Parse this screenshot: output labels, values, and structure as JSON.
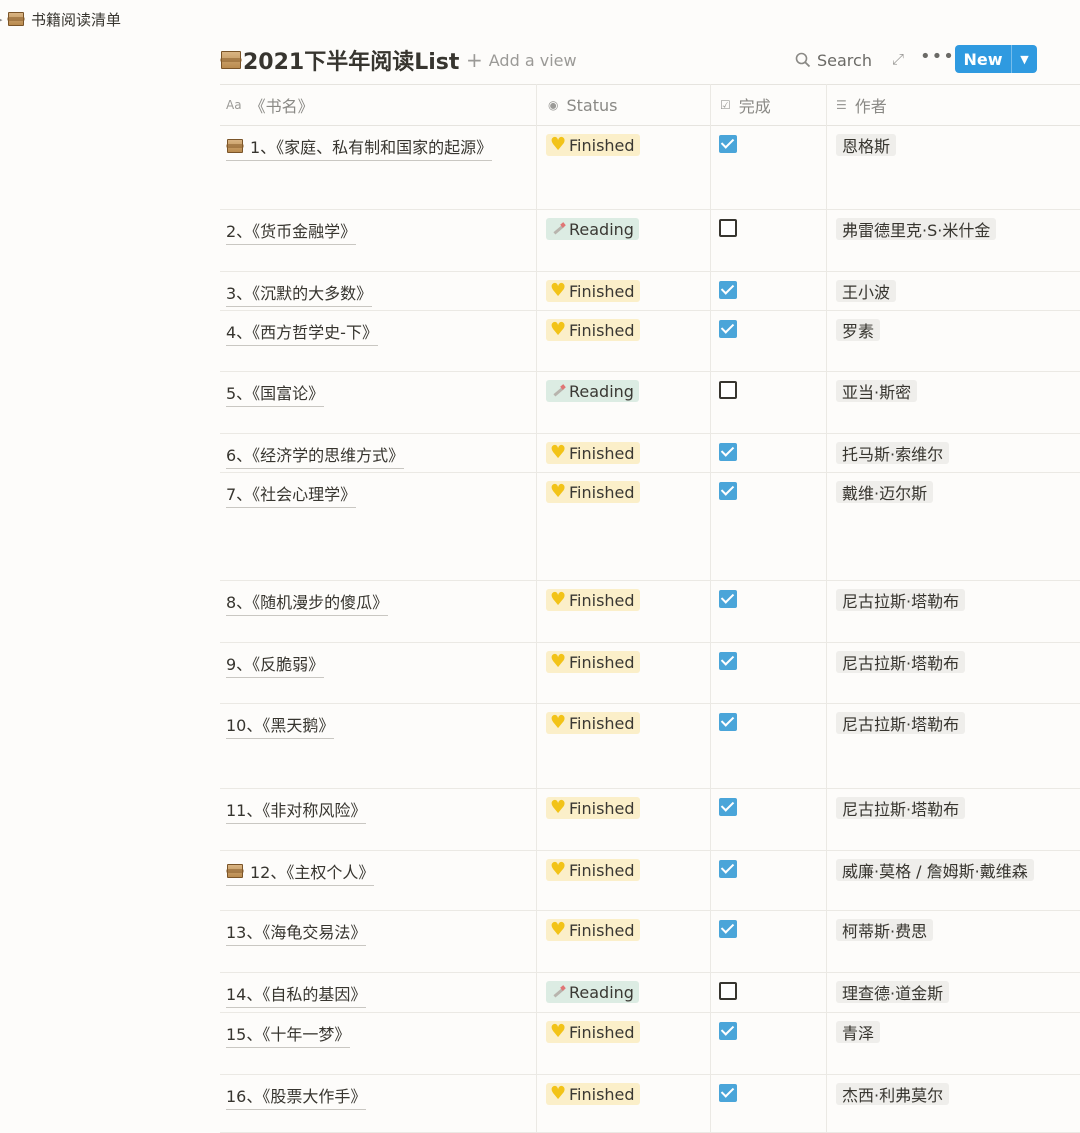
{
  "breadcrumb": {
    "label": "书籍阅读清单"
  },
  "header": {
    "title": "2021下半年阅读List",
    "add_view": "Add a view",
    "search": "Search",
    "new": "New"
  },
  "columns": [
    {
      "label": "《书名》",
      "icon": "text-aa-icon"
    },
    {
      "label": "Status",
      "icon": "select-icon"
    },
    {
      "label": "完成",
      "icon": "checkbox-icon"
    },
    {
      "label": "作者",
      "icon": "list-icon"
    }
  ],
  "rows": [
    {
      "title": "1、《家庭、私有制和国家的起源》",
      "scroll_icon": true,
      "status": "Finished",
      "done": true,
      "author": "恩格斯"
    },
    {
      "title": "2、《货币金融学》",
      "scroll_icon": false,
      "status": "Reading",
      "done": false,
      "author": "弗雷德里克·S·米什金"
    },
    {
      "title": "3、《沉默的大多数》",
      "scroll_icon": false,
      "status": "Finished",
      "done": true,
      "author": "王小波"
    },
    {
      "title": "4、《西方哲学史-下》",
      "scroll_icon": false,
      "status": "Finished",
      "done": true,
      "author": "罗素"
    },
    {
      "title": "5、《国富论》",
      "scroll_icon": false,
      "status": "Reading",
      "done": false,
      "author": "亚当·斯密"
    },
    {
      "title": "6、《经济学的思维方式》",
      "scroll_icon": false,
      "status": "Finished",
      "done": true,
      "author": "托马斯·索维尔"
    },
    {
      "title": "7、《社会心理学》",
      "scroll_icon": false,
      "status": "Finished",
      "done": true,
      "author": "戴维·迈尔斯"
    },
    {
      "title": "8、《随机漫步的傻瓜》",
      "scroll_icon": false,
      "status": "Finished",
      "done": true,
      "author": "尼古拉斯·塔勒布"
    },
    {
      "title": "9、《反脆弱》",
      "scroll_icon": false,
      "status": "Finished",
      "done": true,
      "author": "尼古拉斯·塔勒布"
    },
    {
      "title": "10、《黑天鹅》",
      "scroll_icon": false,
      "status": "Finished",
      "done": true,
      "author": "尼古拉斯·塔勒布"
    },
    {
      "title": "11、《非对称风险》",
      "scroll_icon": false,
      "status": "Finished",
      "done": true,
      "author": "尼古拉斯·塔勒布"
    },
    {
      "title": "12、《主权个人》",
      "scroll_icon": true,
      "status": "Finished",
      "done": true,
      "author": "威廉·莫格 / 詹姆斯·戴维森"
    },
    {
      "title": "13、《海龟交易法》",
      "scroll_icon": false,
      "status": "Finished",
      "done": true,
      "author": "柯蒂斯·费思"
    },
    {
      "title": "14、《自私的基因》",
      "scroll_icon": false,
      "status": "Reading",
      "done": false,
      "author": "理查德·道金斯"
    },
    {
      "title": "15、《十年一梦》",
      "scroll_icon": false,
      "status": "Finished",
      "done": true,
      "author": "青泽"
    },
    {
      "title": "16、《股票大作手》",
      "scroll_icon": false,
      "status": "Finished",
      "done": true,
      "author": "杰西·利弗莫尔"
    }
  ]
}
